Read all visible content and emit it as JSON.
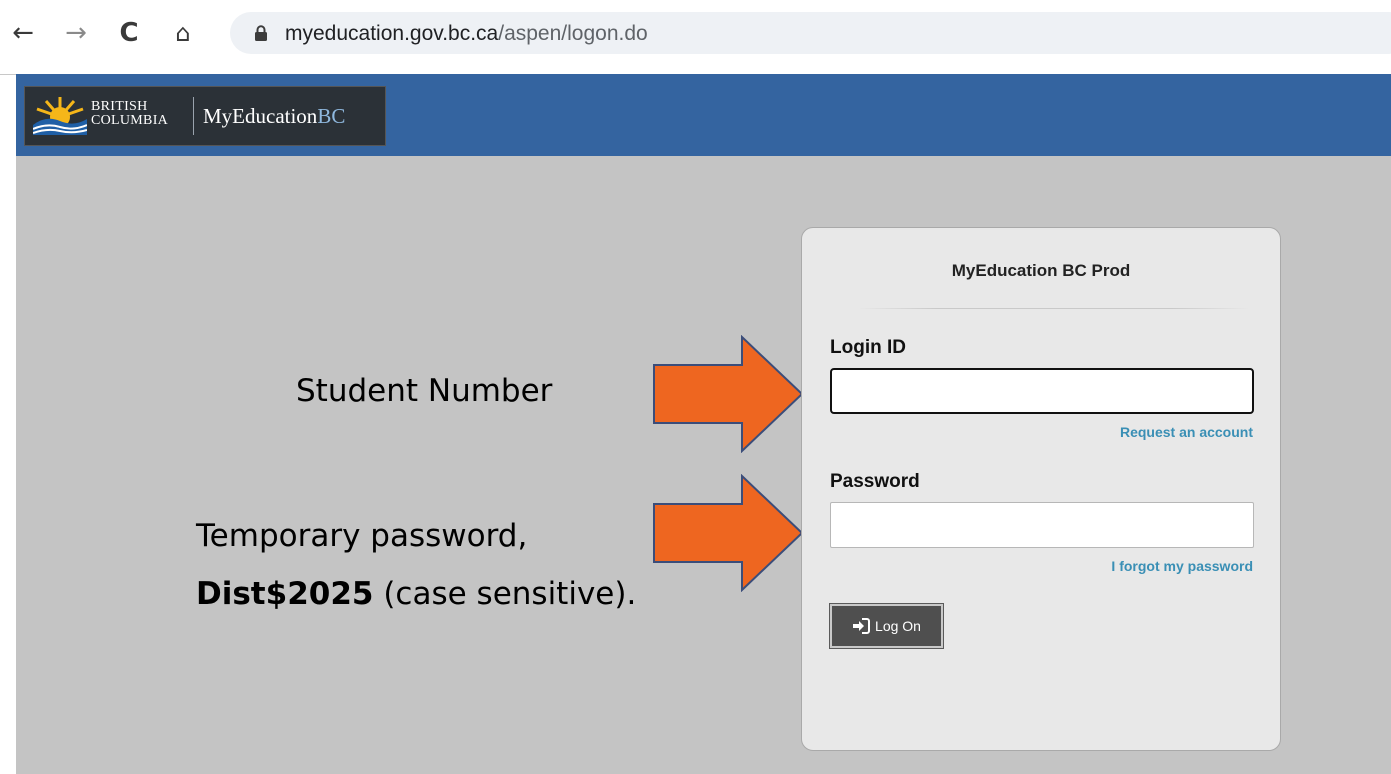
{
  "browser": {
    "url_domain": "myeducation.gov.bc.ca",
    "url_path": "/aspen/logon.do"
  },
  "header": {
    "province_line1": "BRITISH",
    "province_line2": "COLUMBIA",
    "brand_main": "MyEducation",
    "brand_suffix": "BC"
  },
  "annotations": {
    "student_number": "Student Number",
    "temp_password_line1": "Temporary password,",
    "temp_password_code": "Dist$2025",
    "temp_password_rest": " (case sensitive).",
    "arrow_color": "#ee6620"
  },
  "login": {
    "title": "MyEducation BC Prod",
    "login_id_label": "Login ID",
    "login_id_value": "",
    "request_account_link": "Request an account",
    "password_label": "Password",
    "password_value": "",
    "forgot_password_link": "I forgot my password",
    "logon_button": "Log On"
  },
  "colors": {
    "header_blue": "#3464a0",
    "page_gray": "#c4c4c4",
    "link_blue": "#3a8fb5"
  }
}
